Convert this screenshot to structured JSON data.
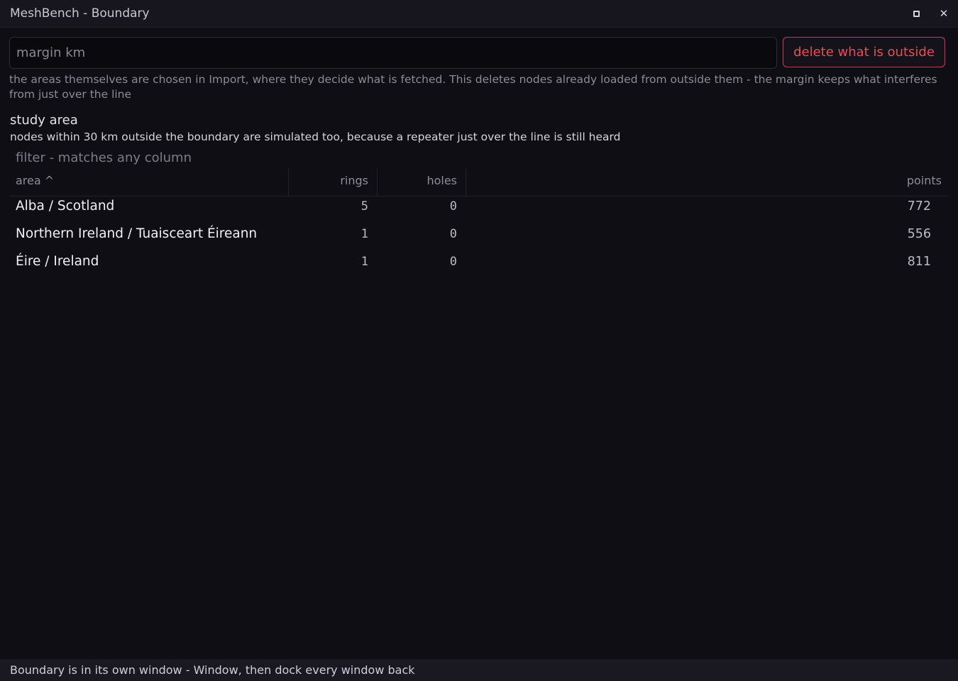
{
  "window": {
    "title": "MeshBench - Boundary",
    "restore_icon": "restore-window-icon",
    "close_icon": "close-icon",
    "close_glyph": "✕"
  },
  "toolbar": {
    "margin_placeholder": "margin km",
    "margin_value": "",
    "delete_label": "delete what is outside",
    "delete_color": "#ec4a5c"
  },
  "help_text": "the areas themselves are chosen in Import, where they decide what is fetched. This deletes nodes already loaded from outside them - the margin keeps what interferes from just over the line",
  "study_area": {
    "title": "study area",
    "description": "nodes within 30 km outside the boundary are simulated too, because a repeater just over the line is still heard"
  },
  "table": {
    "filter_placeholder": "filter - matches any column",
    "columns": {
      "area": "area ^",
      "rings": "rings",
      "holes": "holes",
      "points": "points"
    },
    "rows": [
      {
        "area": "Alba / Scotland",
        "rings": "5",
        "holes": "0",
        "points": "772"
      },
      {
        "area": "Northern Ireland / Tuaisceart Éireann",
        "rings": "1",
        "holes": "0",
        "points": "556"
      },
      {
        "area": "Éire / Ireland",
        "rings": "1",
        "holes": "0",
        "points": "811"
      }
    ]
  },
  "status": {
    "text": "Boundary is in its own window - Window, then dock every window back"
  }
}
